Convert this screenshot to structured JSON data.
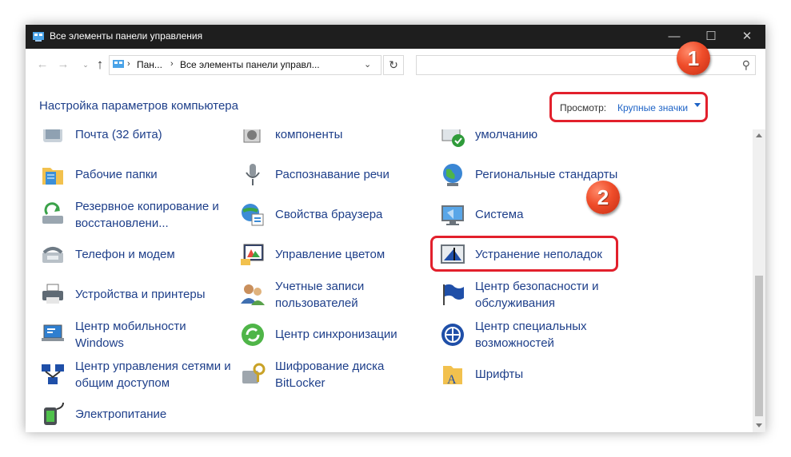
{
  "window": {
    "title": "Все элементы панели управления",
    "controls": {
      "minimize": "—",
      "maximize": "☐",
      "close": "✕"
    }
  },
  "navbar": {
    "back_icon": "←",
    "forward_icon": "→",
    "recent_icon": "⌄",
    "up_icon": "↑",
    "breadcrumb": [
      "Пан...",
      "Все элементы панели управл..."
    ],
    "separator": "›",
    "dropdown_icon": "⌄",
    "refresh_icon": "↻",
    "search_icon": "⚲",
    "search_value": ""
  },
  "header": {
    "title": "Настройка параметров компьютера",
    "view_label": "Просмотр:",
    "view_value": "Крупные значки"
  },
  "annotations": {
    "badge1": "1",
    "badge2": "2",
    "color": "#e2202c"
  },
  "items": [
    {
      "label": "Почта (32 бита)",
      "icon": "mail-icon"
    },
    {
      "label": "Рабочие папки",
      "icon": "work-folders-icon"
    },
    {
      "label": "Резервное копирование и восстановлени...",
      "icon": "backup-icon"
    },
    {
      "label": "Телефон и модем",
      "icon": "phone-modem-icon"
    },
    {
      "label": "Устройства и принтеры",
      "icon": "printer-icon"
    },
    {
      "label": "Центр мобильности Windows",
      "icon": "mobility-icon"
    },
    {
      "label": "Центр управления сетями и общим доступом",
      "icon": "network-icon"
    },
    {
      "label": "Электропитание",
      "icon": "power-icon"
    },
    {
      "label": "компоненты",
      "icon": "programs-icon"
    },
    {
      "label": "Распознавание речи",
      "icon": "microphone-icon"
    },
    {
      "label": "Свойства браузера",
      "icon": "browser-icon"
    },
    {
      "label": "Управление цветом",
      "icon": "color-management-icon"
    },
    {
      "label": "Учетные записи пользователей",
      "icon": "users-icon"
    },
    {
      "label": "Центр синхронизации",
      "icon": "sync-icon"
    },
    {
      "label": "Шифрование диска BitLocker",
      "icon": "bitlocker-icon"
    },
    {
      "label": "умолчанию",
      "icon": "default-programs-icon"
    },
    {
      "label": "Региональные стандарты",
      "icon": "globe-icon"
    },
    {
      "label": "Система",
      "icon": "system-icon"
    },
    {
      "label": "Устранение неполадок",
      "icon": "troubleshoot-icon"
    },
    {
      "label": "Центр безопасности и обслуживания",
      "icon": "flag-icon"
    },
    {
      "label": "Центр специальных возможностей",
      "icon": "accessibility-icon"
    },
    {
      "label": "Шрифты",
      "icon": "fonts-icon"
    }
  ],
  "colors": {
    "link": "#1e3f8a",
    "accent": "#1e63c6",
    "titlebar": "#1e1e1e"
  }
}
